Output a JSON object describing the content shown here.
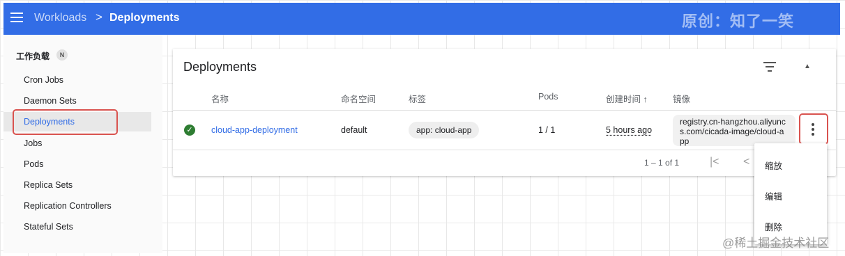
{
  "header": {
    "breadcrumb_parent": "Workloads",
    "breadcrumb_separator": ">",
    "breadcrumb_current": "Deployments",
    "watermark": "原创：知了一笑"
  },
  "sidebar": {
    "section_title": "工作负载",
    "section_badge": "N",
    "items": [
      {
        "label": "Cron Jobs"
      },
      {
        "label": "Daemon Sets"
      },
      {
        "label": "Deployments"
      },
      {
        "label": "Jobs"
      },
      {
        "label": "Pods"
      },
      {
        "label": "Replica Sets"
      },
      {
        "label": "Replication Controllers"
      },
      {
        "label": "Stateful Sets"
      }
    ]
  },
  "card": {
    "title": "Deployments",
    "columns": {
      "name": "名称",
      "namespace": "命名空间",
      "labels": "标签",
      "pods": "Pods",
      "created": "创建时间 ↑",
      "image": "镜像"
    },
    "row": {
      "name": "cloud-app-deployment",
      "namespace": "default",
      "label": "app: cloud-app",
      "pods": "1 / 1",
      "created": "5 hours ago",
      "image": "registry.cn-hangzhou.aliyuncs.com/cicada-image/cloud-app"
    },
    "pagination": "1 – 1 of 1"
  },
  "context_menu": {
    "items": [
      "缩放",
      "编辑",
      "删除"
    ]
  },
  "footer_watermark": "@稀土掘金技术社区"
}
